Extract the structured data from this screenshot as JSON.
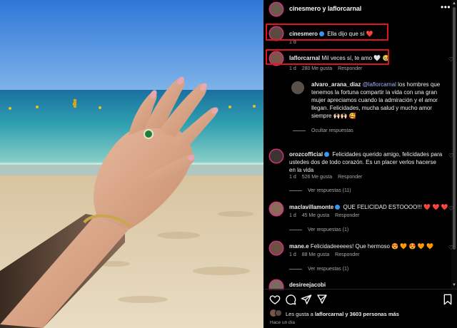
{
  "post": {
    "header": "cinesmero y laflorcarnal",
    "caption_user": "cinesmero",
    "caption_text": "Ella dijo que sí",
    "caption_emoji": "❤️",
    "caption_time": "1 d"
  },
  "comments": [
    {
      "user": "laflorcarnal",
      "text": "Mil veces sí, te amo",
      "emoji": "🤍 🥹",
      "time": "1 d",
      "likes": "280 Me gusta",
      "reply": "Responder"
    },
    {
      "user": "alvaro_arana_diaz",
      "mention": "@laflorcarnal",
      "text": "los hombres que tenemos la fortuna compartir la vida con una gran mujer apreciamos cuando la admiración y el amor llegan. Felicidades, mucha salud y mucho amor siempre",
      "emoji": "🙌🏻🙌🏻 🥰",
      "hide_replies": "Ocultar respuestas"
    },
    {
      "user": "orozcofficial",
      "text": "Felicidades querido amigo, felicidades para ustedes dos de todo corazón. Es un placer verlos hacerse en la vida",
      "time": "1 d",
      "likes": "526 Me gusta",
      "reply": "Responder",
      "view_replies": "Ver respuestas (11)"
    },
    {
      "user": "maclavillamonte",
      "text": "QUE FELICIDAD ESTOOOO!!!",
      "emoji": "❤️ ❤️ ❤️",
      "time": "1 d",
      "likes": "45 Me gusta",
      "reply": "Responder",
      "view_replies": "Ver respuestas (1)"
    },
    {
      "user": "mane.e",
      "text": "Felicidadeeeees! Que hermoso",
      "emoji": "😍 🧡 😍 🧡 🧡",
      "time": "1 d",
      "likes": "88 Me gusta",
      "reply": "Responder",
      "view_replies": "Ver respuestas (1)"
    },
    {
      "user": "desireejacobi"
    }
  ],
  "footer": {
    "likes_prefix": "Les gusta a",
    "likes_user": "laflorcarnal",
    "likes_suffix": "y 3603 personas más",
    "time": "Hace un día"
  },
  "icons": {
    "like": "heart-icon",
    "comment": "comment-icon",
    "share": "share-icon",
    "save": "bookmark-icon",
    "more": "more-options-icon",
    "verified": "verified-badge-icon"
  },
  "colors": {
    "highlight_box": "#e0141e",
    "mention": "#a7b6ff",
    "verified": "#3897f0"
  }
}
